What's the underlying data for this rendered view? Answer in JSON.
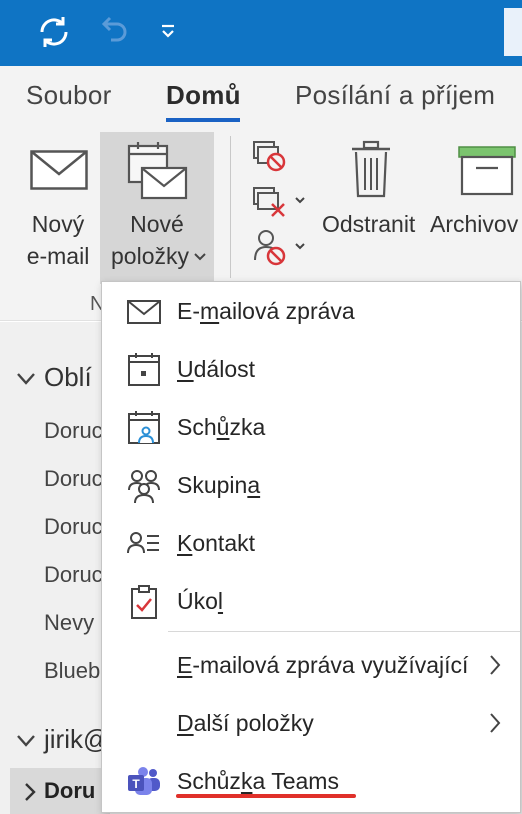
{
  "titlebar": {
    "icons": [
      "sync-icon",
      "undo-icon",
      "customize-quick-access-icon"
    ]
  },
  "tabs": [
    {
      "label": "Soubor",
      "active": false
    },
    {
      "label": "Domů",
      "active": true
    },
    {
      "label": "Posílání a příjem",
      "active": false
    }
  ],
  "ribbon": {
    "new_email": {
      "line1": "Nový",
      "line2": "e-mail"
    },
    "new_items": {
      "line1": "Nové",
      "line2": "položky"
    },
    "delete_label": "Odstranit",
    "archive_label": "Archivov",
    "group_label_fragment": "N"
  },
  "folders": {
    "favorites_header": "Oblí",
    "items": [
      "Doruc",
      "Doruc",
      "Doruc",
      "Doruc",
      "Nevy",
      "Blueb"
    ],
    "account_header": "jirik@",
    "selected_item": "Doru"
  },
  "menu": {
    "items": [
      {
        "pre": "E-",
        "key": "m",
        "post": "ailová zpráva",
        "icon": "mail-icon"
      },
      {
        "pre": "",
        "key": "U",
        "post": "dálost",
        "icon": "calendar-event-icon"
      },
      {
        "pre": "Sch",
        "key": "ů",
        "post": "zka",
        "icon": "meeting-icon"
      },
      {
        "pre": "Skupin",
        "key": "a",
        "post": "",
        "icon": "group-icon"
      },
      {
        "pre": "",
        "key": "K",
        "post": "ontakt",
        "icon": "contact-icon"
      },
      {
        "pre": "Úko",
        "key": "l",
        "post": "",
        "icon": "task-icon"
      },
      {
        "pre": "",
        "key": "E",
        "post": "-mailová zpráva využívající",
        "icon": ""
      },
      {
        "pre": "",
        "key": "D",
        "post": "alší položky",
        "icon": ""
      },
      {
        "pre": "Schůz",
        "key": "k",
        "post": "a Teams",
        "icon": "teams-icon"
      }
    ]
  },
  "colors": {
    "titlebar": "#0f74c4",
    "accent": "#1a62c4",
    "annotation_red": "#e0302a"
  }
}
